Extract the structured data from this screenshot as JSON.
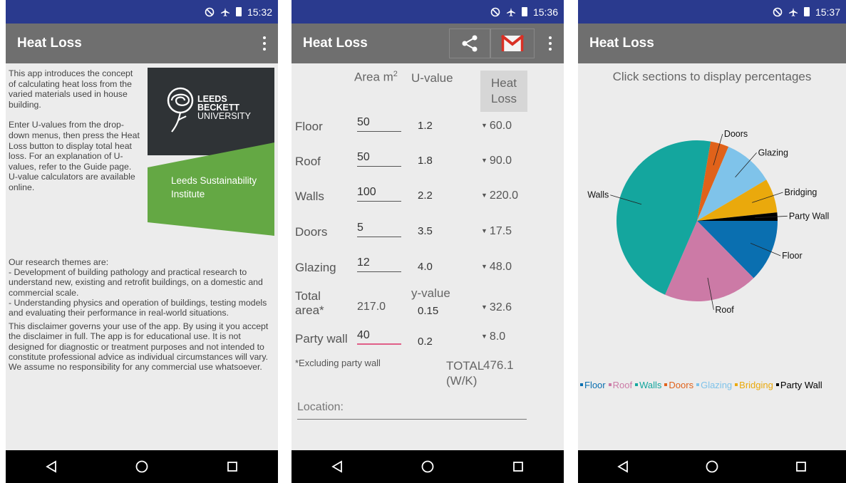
{
  "status_bar": {
    "time_1": "15:32",
    "time_2": "15:36",
    "time_3": "15:37"
  },
  "app_title": "Heat Loss",
  "screen1": {
    "intro_paragraphs": [
      "This app introduces the concept of calculating heat loss from the varied materials used in house building.",
      "Enter U-values from the drop-down menus, then press the Heat Loss button to display total heat loss. For an explanation of U-values, refer to the Guide page. U-value calculators are available online."
    ],
    "logo_university": [
      "LEEDS",
      "BECKETT",
      "UNIVERSITY"
    ],
    "logo_institute": [
      "Leeds Sustainability",
      "Institute"
    ],
    "research_heading": "Our research themes are:",
    "research_items": [
      "- Development of building pathology and practical research to understand new, existing and retrofit buildings, on a domestic and commercial scale.",
      "- Understanding physics and operation of buildings, testing models and evaluating their performance in real-world situations."
    ],
    "disclaimer": "This disclaimer governs your use of the app. By using it you accept the disclaimer in full. The app is for educational use. It is not designed for diagnostic or treatment purposes and not intended to constitute professional advice as individual circumstances will vary. We assume no responsibility for any commercial use whatsoever."
  },
  "screen2": {
    "col_area": "Area m",
    "col_area_sup": "2",
    "col_uvalue": "U-value",
    "heat_loss_button": [
      "Heat",
      "Loss"
    ],
    "rows": [
      {
        "label": "Floor",
        "area": "50",
        "u": "1.2",
        "loss": "60.0"
      },
      {
        "label": "Roof",
        "area": "50",
        "u": "1.8",
        "loss": "90.0"
      },
      {
        "label": "Walls",
        "area": "100",
        "u": "2.2",
        "loss": "220.0"
      },
      {
        "label": "Doors",
        "area": "5",
        "u": "3.5",
        "loss": "17.5"
      },
      {
        "label": "Glazing",
        "area": "12",
        "u": "4.0",
        "loss": "48.0"
      }
    ],
    "total_area_label": [
      "Total",
      "area*"
    ],
    "total_area_value": "217.0",
    "y_value_label": "y-value",
    "y_value": "0.15",
    "y_loss": "32.6",
    "party_wall_label": "Party wall",
    "party_wall_area": "40",
    "party_wall_u": "0.2",
    "party_wall_loss": "8.0",
    "excluding_note": "*Excluding party wall",
    "total_label": "TOTAL",
    "total_unit": "(W/K)",
    "total_value": "476.1",
    "location_placeholder": "Location:"
  },
  "screen3": {
    "instruction": "Click sections to display percentages",
    "colors": {
      "Floor": "#0a6fb0",
      "Roof": "#cc7aa6",
      "Walls": "#14a69e",
      "Doors": "#e0621a",
      "Glazing": "#7fc3ea",
      "Bridging": "#eaa90c",
      "Party Wall": "#000000"
    },
    "chart_data": {
      "type": "pie",
      "title": "",
      "labels": [
        "Floor",
        "Roof",
        "Walls",
        "Doors",
        "Glazing",
        "Bridging",
        "Party Wall"
      ],
      "values": [
        60.0,
        90.0,
        220.0,
        17.5,
        48.0,
        32.6,
        8.0
      ],
      "legend_position": "bottom-left"
    }
  }
}
